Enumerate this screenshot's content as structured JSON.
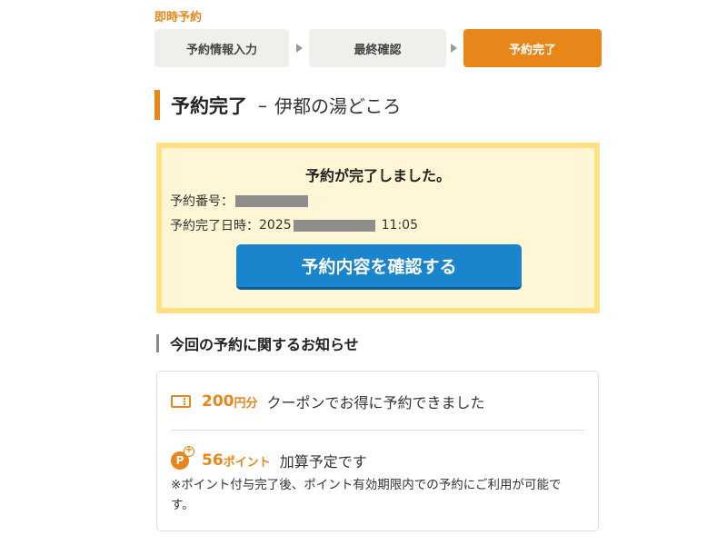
{
  "section_label": "即時予約",
  "steps": [
    {
      "label": "予約情報入力",
      "active": false
    },
    {
      "label": "最終確認",
      "active": false
    },
    {
      "label": "予約完了",
      "active": true
    }
  ],
  "page_title": {
    "main": "予約完了",
    "dash": "–",
    "facility": "伊都の湯どころ"
  },
  "completion": {
    "title": "予約が完了しました。",
    "number_label": "予約番号：",
    "date_label": "予約完了日時：",
    "date_prefix": "2025",
    "time": "11:05",
    "confirm_button": "予約内容を確認する"
  },
  "notice": {
    "heading": "今回の予約に関するお知らせ",
    "coupon": {
      "amount": "200",
      "unit": "円分",
      "text": "クーポンでお得に予約できました",
      "icon": "coupon-icon"
    },
    "points": {
      "amount": "56",
      "unit": "ポイント",
      "text": "加算予定です",
      "icon_letter": "P",
      "icon_plus": "+",
      "icon": "point-plus-icon"
    },
    "note": "※ポイント付与完了後、ポイント有効期限内での予約にご利用が可能です。"
  },
  "colors": {
    "accent": "#e8861a",
    "button": "#1a84cc",
    "highlight_border": "#ffe082",
    "highlight_bg": "#fff6d6"
  }
}
